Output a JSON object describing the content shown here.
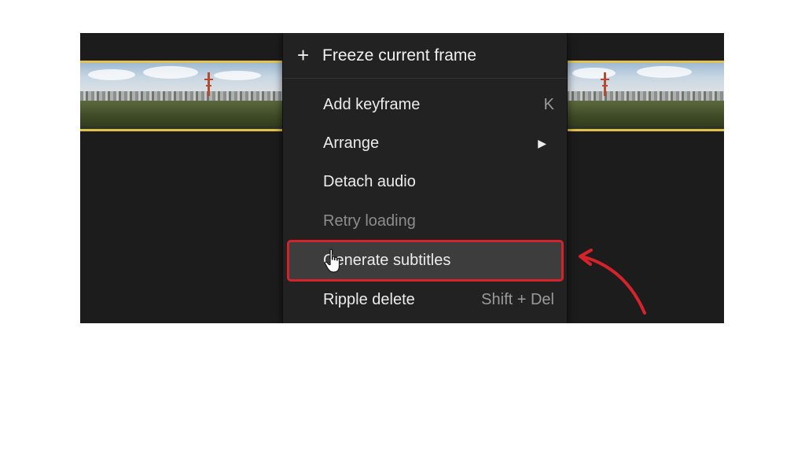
{
  "menu": {
    "top_item": {
      "icon": "plus-icon",
      "label": "Freeze current frame"
    },
    "items": [
      {
        "label": "Add keyframe",
        "shortcut": "K"
      },
      {
        "label": "Arrange",
        "submenu_icon": "chevron-right-icon"
      },
      {
        "label": "Detach audio"
      },
      {
        "label": "Retry loading",
        "disabled": true
      },
      {
        "label": "Generate subtitles",
        "highlighted": true
      },
      {
        "label": "Ripple delete",
        "shortcut": "Shift + Del"
      }
    ]
  },
  "colors": {
    "highlight_border": "#d6232b",
    "annotation_arrow": "#d6232b",
    "clip_border": "#e2c14c",
    "timeline_bg": "#1c1c1c",
    "menu_bg": "#222222"
  },
  "cursor_icon": "hand-pointer-icon",
  "annotation_icon": "curved-arrow-icon"
}
